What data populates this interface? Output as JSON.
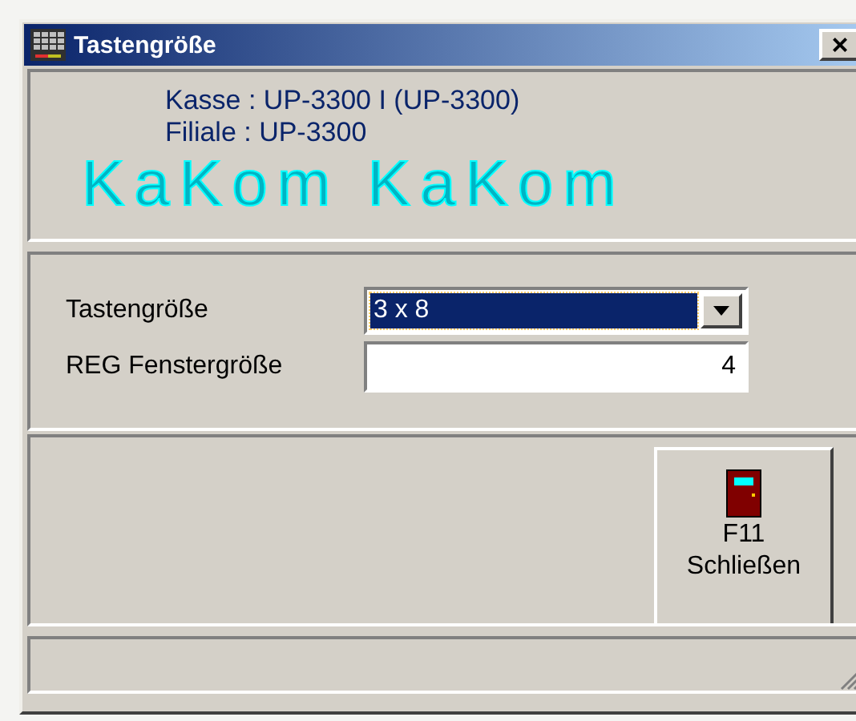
{
  "window": {
    "title": "Tastengröße",
    "close": "×"
  },
  "header": {
    "banner": "KaKom KaKom",
    "lines": [
      "Kasse : UP-3300 I (UP-3300)",
      "Filiale : UP-3300"
    ]
  },
  "form": [
    {
      "kind": "dropdown",
      "label": "Tastengröße",
      "value": "3 x 8",
      "focused": true
    },
    {
      "kind": "text",
      "label": "REG Fenstergröße",
      "value": "4"
    }
  ],
  "buttons": [
    {
      "key": "F11",
      "label": "Schließen"
    }
  ]
}
